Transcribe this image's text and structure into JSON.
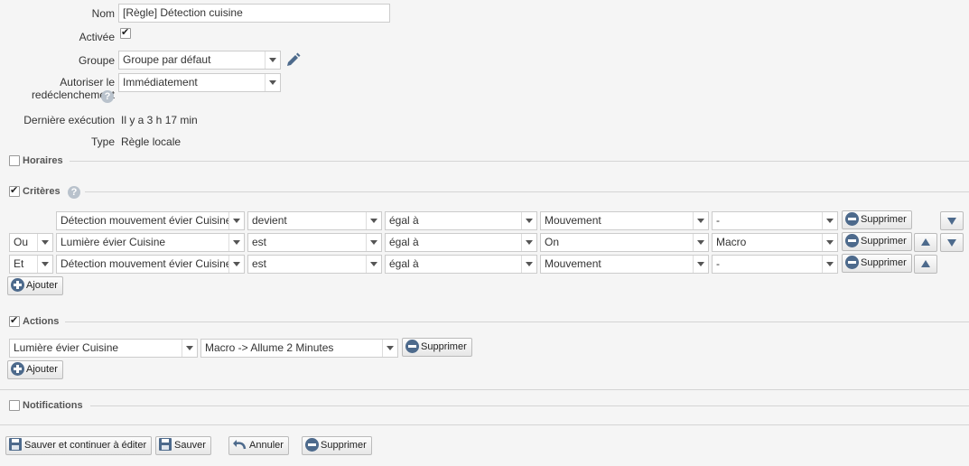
{
  "form": {
    "name_label": "Nom",
    "name_value": "[Règle] Détection cuisine",
    "active_label": "Activée",
    "group_label": "Groupe",
    "group_value": "Groupe par défaut",
    "retrigger_label_1": "Autoriser le",
    "retrigger_label_2": "redéclenchement",
    "retrigger_value": "Immédiatement",
    "last_exec_label": "Dernière exécution",
    "last_exec_value": "Il y a 3 h 17 min",
    "type_label": "Type",
    "type_value": "Règle locale"
  },
  "sections": {
    "schedules": "Horaires",
    "criteria": "Critères",
    "actions": "Actions",
    "notifications": "Notifications"
  },
  "criteria": [
    {
      "connector": "",
      "device": "Détection mouvement évier Cuisine",
      "verb": "devient",
      "operator": "égal à",
      "value": "Mouvement",
      "extra": "-"
    },
    {
      "connector": "Ou",
      "device": "Lumière évier Cuisine",
      "verb": "est",
      "operator": "égal à",
      "value": "On",
      "extra": "Macro"
    },
    {
      "connector": "Et",
      "device": "Détection mouvement évier Cuisine",
      "verb": "est",
      "operator": "égal à",
      "value": "Mouvement",
      "extra": "-"
    }
  ],
  "actions": [
    {
      "device": "Lumière évier Cuisine",
      "command": "Macro -> Allume 2 Minutes"
    }
  ],
  "buttons": {
    "delete": "Supprimer",
    "add": "Ajouter",
    "save_continue": "Sauver et continuer à éditer",
    "save": "Sauver",
    "cancel": "Annuler",
    "delete_rule": "Supprimer"
  },
  "icons": {
    "edit": "pencil-icon",
    "help": "help-icon",
    "remove": "minus-circle-icon",
    "add": "plus-circle-icon",
    "save": "floppy-icon",
    "undo": "undo-icon",
    "up": "arrow-up-icon",
    "down": "arrow-down-icon"
  },
  "colors": {
    "accent": "#4d6a8c",
    "background": "#f5f5f5"
  }
}
